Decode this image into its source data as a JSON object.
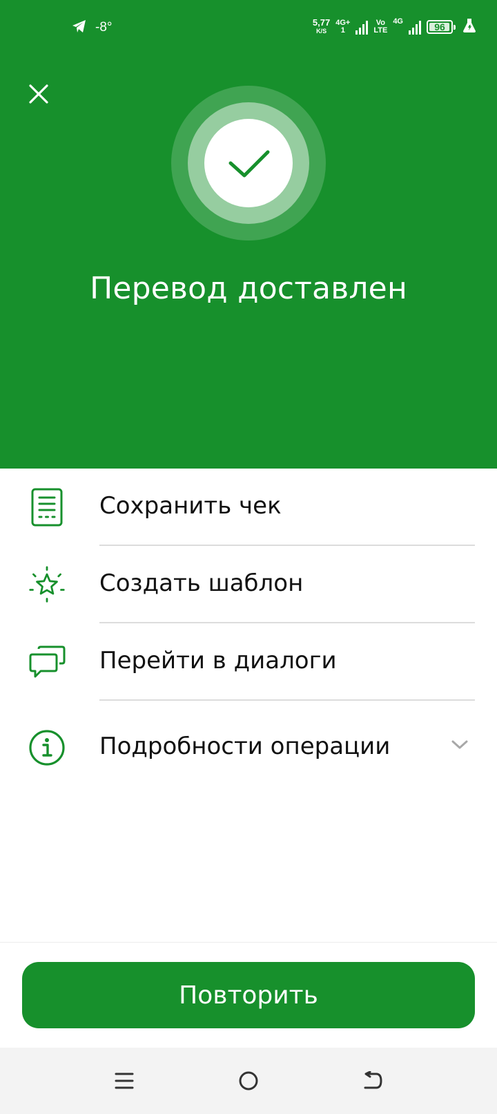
{
  "status_bar": {
    "temperature": "-8°",
    "net_speed_value": "5,77",
    "net_speed_unit": "K/S",
    "network_1": "4G+",
    "network_1_sub": "1",
    "volte_top": "Vo",
    "volte_bottom": "LTE",
    "network_2": "4G",
    "battery_level": "96",
    "battery_fraction": 0.96,
    "icons": [
      "telegram-icon",
      "signal-icon",
      "battery-icon",
      "flask-icon"
    ]
  },
  "header": {
    "close_icon": "close-icon",
    "status_icon": "check-icon",
    "title": "Перевод доставлен",
    "background_color": "#17902c"
  },
  "actions": [
    {
      "label": "Сохранить чек",
      "icon": "receipt-icon"
    },
    {
      "label": "Создать шаблон",
      "icon": "star-icon"
    },
    {
      "label": "Перейти в диалоги",
      "icon": "chat-icon"
    },
    {
      "label": "Подробности операции",
      "icon": "info-icon",
      "expand_icon": "chevron-down-icon"
    }
  ],
  "primary_button": {
    "label": "Повторить",
    "color": "#17902c"
  },
  "nav_bar": {
    "icons": [
      "menu-icon",
      "home-icon",
      "back-icon"
    ]
  }
}
